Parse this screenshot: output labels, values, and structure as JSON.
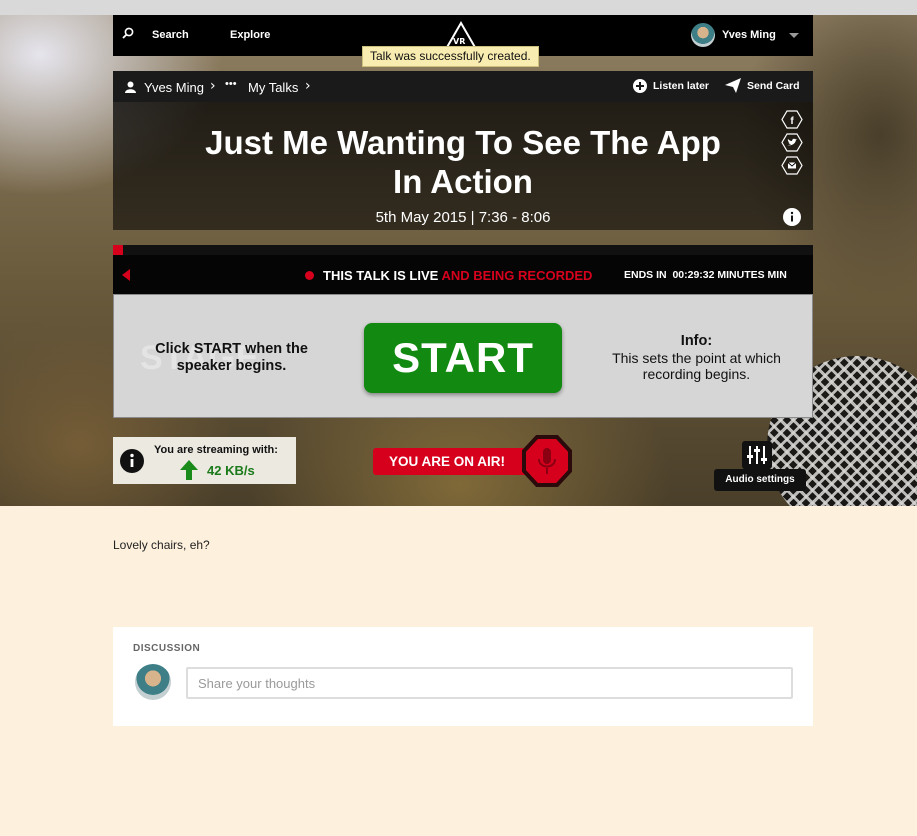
{
  "nav": {
    "search_label": "Search",
    "explore_label": "Explore",
    "logo_text": "VR",
    "user_name": "Yves Ming"
  },
  "toast": {
    "message": "Talk was successfully created."
  },
  "breadcrumb": {
    "user": "Yves Ming",
    "ellipsis": "•••",
    "section": "My Talks"
  },
  "actions": {
    "listen_later": "Listen later",
    "send_card": "Send Card"
  },
  "talk": {
    "title": "Just Me Wanting To See The App In Action",
    "date": "5th May 2015 | 7:36 - 8:06"
  },
  "share": {
    "icons": [
      "facebook-icon",
      "twitter-icon",
      "email-icon"
    ]
  },
  "live": {
    "status_white": "THIS TALK IS LIVE",
    "status_red": "AND BEING RECORDED",
    "ends_label": "ENDS IN",
    "countdown": "00:29:32 MINUTES MIN",
    "progress_fraction": 0.014
  },
  "stage": {
    "watermark": "STAGE",
    "instruction": "Click START when the speaker begins.",
    "start_label": "START",
    "info_heading": "Info:",
    "info_body": "This sets the point at which recording begins."
  },
  "streaming": {
    "label": "You are streaming with:",
    "rate": "42 KB/s"
  },
  "on_air": {
    "label": "YOU ARE ON AIR!"
  },
  "audio": {
    "label": "Audio settings"
  },
  "description": "Lovely chairs, eh?",
  "discussion": {
    "title": "DISCUSSION",
    "placeholder": "Share your thoughts"
  },
  "colors": {
    "accent_red": "#d6001c",
    "start_green": "#128a12",
    "page_bg": "#fdf1dd"
  }
}
